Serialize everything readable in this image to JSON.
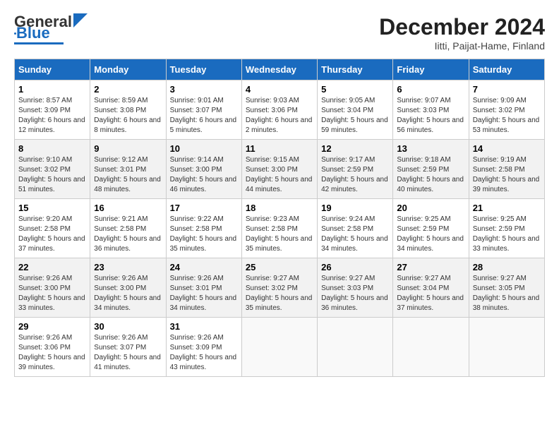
{
  "logo": {
    "text1": "General",
    "text2": "Blue"
  },
  "title": "December 2024",
  "subtitle": "Iitti, Paijat-Hame, Finland",
  "headers": [
    "Sunday",
    "Monday",
    "Tuesday",
    "Wednesday",
    "Thursday",
    "Friday",
    "Saturday"
  ],
  "weeks": [
    [
      {
        "day": "1",
        "info": "Sunrise: 8:57 AM\nSunset: 3:09 PM\nDaylight: 6 hours and 12 minutes."
      },
      {
        "day": "2",
        "info": "Sunrise: 8:59 AM\nSunset: 3:08 PM\nDaylight: 6 hours and 8 minutes."
      },
      {
        "day": "3",
        "info": "Sunrise: 9:01 AM\nSunset: 3:07 PM\nDaylight: 6 hours and 5 minutes."
      },
      {
        "day": "4",
        "info": "Sunrise: 9:03 AM\nSunset: 3:06 PM\nDaylight: 6 hours and 2 minutes."
      },
      {
        "day": "5",
        "info": "Sunrise: 9:05 AM\nSunset: 3:04 PM\nDaylight: 5 hours and 59 minutes."
      },
      {
        "day": "6",
        "info": "Sunrise: 9:07 AM\nSunset: 3:03 PM\nDaylight: 5 hours and 56 minutes."
      },
      {
        "day": "7",
        "info": "Sunrise: 9:09 AM\nSunset: 3:02 PM\nDaylight: 5 hours and 53 minutes."
      }
    ],
    [
      {
        "day": "8",
        "info": "Sunrise: 9:10 AM\nSunset: 3:02 PM\nDaylight: 5 hours and 51 minutes."
      },
      {
        "day": "9",
        "info": "Sunrise: 9:12 AM\nSunset: 3:01 PM\nDaylight: 5 hours and 48 minutes."
      },
      {
        "day": "10",
        "info": "Sunrise: 9:14 AM\nSunset: 3:00 PM\nDaylight: 5 hours and 46 minutes."
      },
      {
        "day": "11",
        "info": "Sunrise: 9:15 AM\nSunset: 3:00 PM\nDaylight: 5 hours and 44 minutes."
      },
      {
        "day": "12",
        "info": "Sunrise: 9:17 AM\nSunset: 2:59 PM\nDaylight: 5 hours and 42 minutes."
      },
      {
        "day": "13",
        "info": "Sunrise: 9:18 AM\nSunset: 2:59 PM\nDaylight: 5 hours and 40 minutes."
      },
      {
        "day": "14",
        "info": "Sunrise: 9:19 AM\nSunset: 2:58 PM\nDaylight: 5 hours and 39 minutes."
      }
    ],
    [
      {
        "day": "15",
        "info": "Sunrise: 9:20 AM\nSunset: 2:58 PM\nDaylight: 5 hours and 37 minutes."
      },
      {
        "day": "16",
        "info": "Sunrise: 9:21 AM\nSunset: 2:58 PM\nDaylight: 5 hours and 36 minutes."
      },
      {
        "day": "17",
        "info": "Sunrise: 9:22 AM\nSunset: 2:58 PM\nDaylight: 5 hours and 35 minutes."
      },
      {
        "day": "18",
        "info": "Sunrise: 9:23 AM\nSunset: 2:58 PM\nDaylight: 5 hours and 35 minutes."
      },
      {
        "day": "19",
        "info": "Sunrise: 9:24 AM\nSunset: 2:58 PM\nDaylight: 5 hours and 34 minutes."
      },
      {
        "day": "20",
        "info": "Sunrise: 9:25 AM\nSunset: 2:59 PM\nDaylight: 5 hours and 34 minutes."
      },
      {
        "day": "21",
        "info": "Sunrise: 9:25 AM\nSunset: 2:59 PM\nDaylight: 5 hours and 33 minutes."
      }
    ],
    [
      {
        "day": "22",
        "info": "Sunrise: 9:26 AM\nSunset: 3:00 PM\nDaylight: 5 hours and 33 minutes."
      },
      {
        "day": "23",
        "info": "Sunrise: 9:26 AM\nSunset: 3:00 PM\nDaylight: 5 hours and 34 minutes."
      },
      {
        "day": "24",
        "info": "Sunrise: 9:26 AM\nSunset: 3:01 PM\nDaylight: 5 hours and 34 minutes."
      },
      {
        "day": "25",
        "info": "Sunrise: 9:27 AM\nSunset: 3:02 PM\nDaylight: 5 hours and 35 minutes."
      },
      {
        "day": "26",
        "info": "Sunrise: 9:27 AM\nSunset: 3:03 PM\nDaylight: 5 hours and 36 minutes."
      },
      {
        "day": "27",
        "info": "Sunrise: 9:27 AM\nSunset: 3:04 PM\nDaylight: 5 hours and 37 minutes."
      },
      {
        "day": "28",
        "info": "Sunrise: 9:27 AM\nSunset: 3:05 PM\nDaylight: 5 hours and 38 minutes."
      }
    ],
    [
      {
        "day": "29",
        "info": "Sunrise: 9:26 AM\nSunset: 3:06 PM\nDaylight: 5 hours and 39 minutes."
      },
      {
        "day": "30",
        "info": "Sunrise: 9:26 AM\nSunset: 3:07 PM\nDaylight: 5 hours and 41 minutes."
      },
      {
        "day": "31",
        "info": "Sunrise: 9:26 AM\nSunset: 3:09 PM\nDaylight: 5 hours and 43 minutes."
      },
      null,
      null,
      null,
      null
    ]
  ]
}
